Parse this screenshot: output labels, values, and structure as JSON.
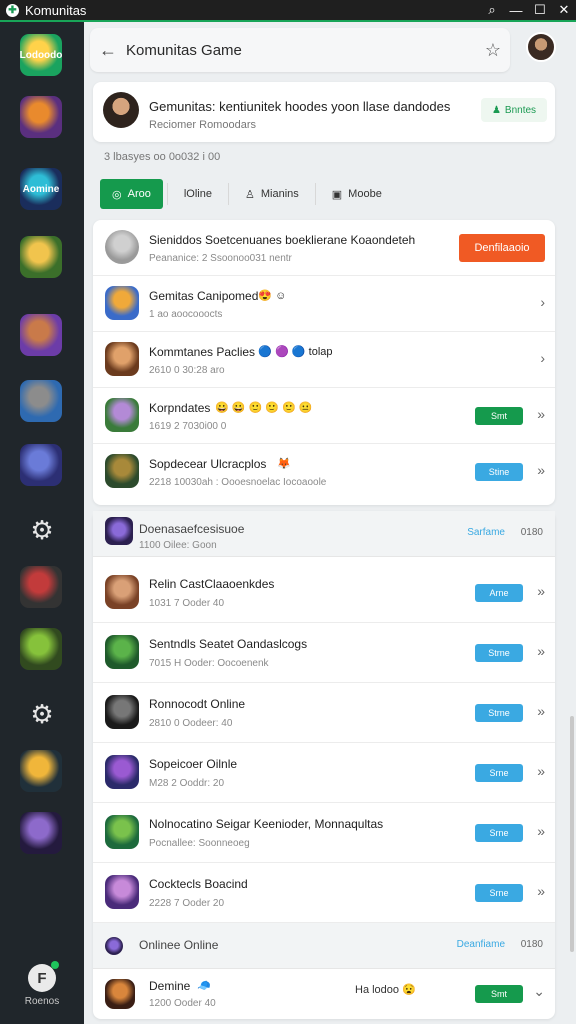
{
  "window": {
    "title": "Komunitas"
  },
  "sidebar": {
    "items": [
      {
        "name": "heart-app",
        "label": "Lodoodo",
        "colors": [
          "#1aa35f",
          "#ffd24a"
        ]
      },
      {
        "name": "game-1",
        "label": "",
        "colors": [
          "#5a2f7f",
          "#e98a2d"
        ]
      },
      {
        "name": "game-2",
        "label": "Aomine",
        "colors": [
          "#1a2d5c",
          "#2ebdd6"
        ]
      },
      {
        "name": "game-3",
        "label": "",
        "colors": [
          "#3b6f2a",
          "#f1c44d"
        ]
      },
      {
        "name": "game-4",
        "label": "",
        "colors": [
          "#6c3ca8",
          "#c97a4a"
        ]
      },
      {
        "name": "game-5",
        "label": "",
        "colors": [
          "#2e6ab1",
          "#8c8c8c"
        ]
      },
      {
        "name": "game-6",
        "label": "",
        "colors": [
          "#2c2f74",
          "#6a7bd8"
        ]
      },
      {
        "name": "gear-1",
        "label": ""
      },
      {
        "name": "game-7",
        "label": "",
        "colors": [
          "#333333",
          "#c23b3b"
        ]
      },
      {
        "name": "game-8",
        "label": "",
        "colors": [
          "#314a1f",
          "#86c23b"
        ]
      },
      {
        "name": "gear-2",
        "label": ""
      },
      {
        "name": "game-9",
        "label": "",
        "colors": [
          "#20303a",
          "#f0b63a"
        ]
      },
      {
        "name": "game-10",
        "label": "",
        "colors": [
          "#241a3e",
          "#8d6acb"
        ]
      }
    ],
    "profile": {
      "initial": "F",
      "label": "Roenos"
    }
  },
  "topbar": {
    "title": "Komunitas Game"
  },
  "header": {
    "title": "Gemunitas: kentiunitek hoodes yoon llase dandodes",
    "subtitle": "Reciomer Romoodars",
    "button_label": "Bnntes"
  },
  "meta_line": "3 lbasyes oo 0o032 i 00",
  "tabs": [
    {
      "label": "Aroo",
      "icon": "◎",
      "active": true
    },
    {
      "label": "lOline",
      "icon": "",
      "active": false
    },
    {
      "label": "Mianins",
      "icon": "♙",
      "active": false
    },
    {
      "label": "Moobe",
      "icon": "▣",
      "active": false
    }
  ],
  "list_top": [
    {
      "name": "Sieniddos Soetcenuanes boeklierane Koaondeteh",
      "sub": "Peananice: 2 Ssoonoo031 nentr",
      "button": "Denfilaaoio",
      "button_color": "orange",
      "avatar_colors": [
        "#9a9a9a",
        "#d0d0d0"
      ],
      "chevron": ""
    },
    {
      "name": "Gemitas Canipomed",
      "emoji": "😍 ☺",
      "sub": "1 ao aoocooocts",
      "avatar_colors": [
        "#3a6bc9",
        "#f0a93a"
      ],
      "chevron": "›"
    },
    {
      "name": "Kommtanes Paclies",
      "emoji": "🔵 🟣 🔵 tolap",
      "sub": "2610 0 30:28 aro",
      "avatar_colors": [
        "#6b3b1e",
        "#e0a16a"
      ],
      "chevron": "›"
    },
    {
      "name": "Korpndates",
      "emoji": "😀 😀 🙂 🙂 🙂 😐",
      "sub": "1619 2 7030i00 0",
      "button": "Smt",
      "button_color": "green",
      "avatar_colors": [
        "#3a7b3a",
        "#b38ad6"
      ],
      "chevron": "»"
    },
    {
      "name": "Sopdecear Ulcracplos",
      "emoji": "🦊",
      "sub": "2218 10030ah : Oooesnoelac Iocoaoole",
      "button": "Stine",
      "button_color": "blue",
      "avatar_colors": [
        "#2c4a2c",
        "#a8893a"
      ],
      "chevron": "»"
    }
  ],
  "section1": {
    "name": "Doenasaefcesisuoe",
    "sub": "1100 Oilee: Goon",
    "link": "Sarfame",
    "count": "0180"
  },
  "list_bottom": [
    {
      "name": "Relin CastClaaoenkdes",
      "sub": "1031 7 Ooder 40",
      "button": "Arne",
      "avatar_colors": [
        "#7a4226",
        "#d9a077"
      ]
    },
    {
      "name": "Sentndls Seatet Oandaslcogs",
      "sub": "7015 H Ooder: Oocoenenk",
      "button": "Strne",
      "avatar_colors": [
        "#1f5a2b",
        "#5bb34a"
      ]
    },
    {
      "name": "Ronnocodt Online",
      "sub": "2810 0 Oodeer: 40",
      "button": "Strne",
      "avatar_colors": [
        "#1a1a1a",
        "#777777"
      ]
    },
    {
      "name": "Sopeicoer Oilnle",
      "sub": "M28 2 Ooddr: 20",
      "button": "Srne",
      "avatar_colors": [
        "#2b2a6a",
        "#9a5ad2"
      ]
    },
    {
      "name": "Nolnocatino Seigar Keenioder, Monnaqultas",
      "sub": "Pocnallee: Soonneoeg",
      "button": "Srne",
      "avatar_colors": [
        "#1d6a3c",
        "#7ac24c"
      ]
    },
    {
      "name": "Cocktecls Boacind",
      "sub": "2228 7 Ooder 20",
      "button": "Srne",
      "avatar_colors": [
        "#4a2b7a",
        "#c78ad9"
      ]
    }
  ],
  "section2": {
    "name": "Onlinee Online",
    "link": "Deanfiame",
    "count": "0180"
  },
  "last_row": {
    "name": "Demine",
    "emoji": "🧢",
    "sub": "1200 Ooder 40",
    "mid_text": "Ha lodoo 😧",
    "button": "Smt",
    "chevron": "⌄",
    "avatar_colors": [
      "#3a1e14",
      "#d9863c"
    ]
  }
}
